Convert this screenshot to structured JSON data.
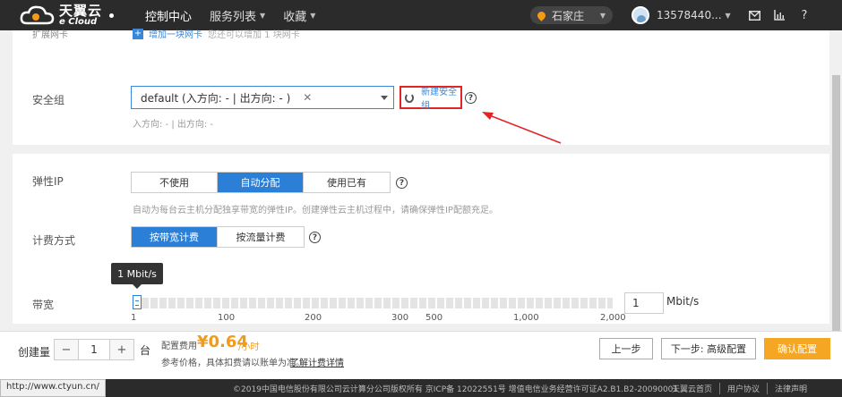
{
  "colors": {
    "accent": "#2c7fd6",
    "price": "#f39a1a",
    "highlight_border": "#e02525",
    "confirm": "#f5a623",
    "topbar": "#2b2b2b"
  },
  "topbar": {
    "logo_cn": "天翼云",
    "logo_en": "e Cloud",
    "nav": [
      "控制中心",
      "服务列表",
      "收藏"
    ],
    "region": "石家庄",
    "user": "13578440...",
    "icons": [
      "mail-icon",
      "chart-icon",
      "help-icon"
    ]
  },
  "network": {
    "extra_nic_label": "扩展网卡",
    "add_nic": "增加一块网卡",
    "add_nic_tip": "您还可以增加 1 块网卡"
  },
  "security_group": {
    "label": "安全组",
    "selected": "default (入方向: - | 出方向: - )",
    "new_button": "新建安全组",
    "hint": "入方向: - | 出方向: -"
  },
  "eip": {
    "label": "弹性IP",
    "options": [
      "不使用",
      "自动分配",
      "使用已有"
    ],
    "selected_index": 1,
    "hint": "自动为每台云主机分配独享带宽的弹性IP。创建弹性云主机过程中，请确保弹性IP配额充足。"
  },
  "billing": {
    "label": "计费方式",
    "options": [
      "按带宽计费",
      "按流量计费"
    ],
    "selected_index": 0
  },
  "bandwidth": {
    "label": "带宽",
    "tooltip": "1 Mbit/s",
    "value": "1",
    "unit": "Mbit/s",
    "ticks": [
      "1",
      "100",
      "200",
      "300",
      "500",
      "1,000",
      "2,000"
    ],
    "slider_fraction": 0
  },
  "bottombar": {
    "qty_label": "创建量",
    "qty_minus": "−",
    "qty_value": "1",
    "qty_plus": "+",
    "qty_unit": "台",
    "fee_label": "配置费用",
    "fee_value": "¥0.64",
    "fee_unit": "/小时",
    "fee_note": "参考价格，具体扣费请以账单为准。",
    "fee_link": "了解计费详情",
    "prev": "上一步",
    "next": "下一步: 高级配置",
    "confirm": "确认配置"
  },
  "footer": {
    "copyright": "©2019中国电信股份有限公司云计算分公司版权所有  京ICP备 12022551号  增值电信业务经营许可证A2.B1.B2-20090001",
    "links": [
      "天翼云首页",
      "用户协议",
      "法律声明"
    ],
    "status_url": "http://www.ctyun.cn/"
  }
}
